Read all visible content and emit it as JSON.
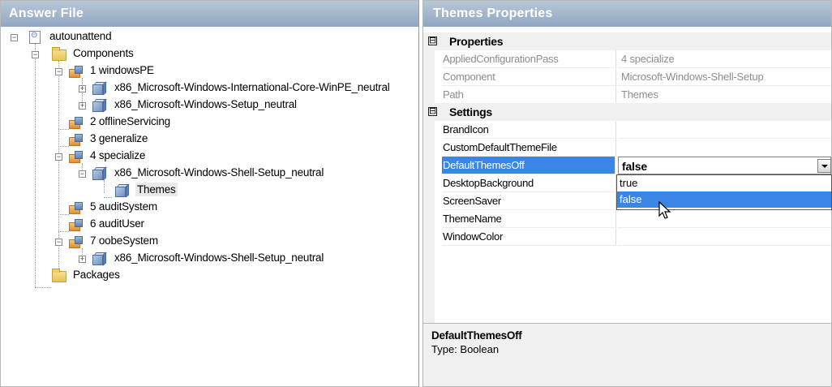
{
  "answer_file": {
    "title": "Answer File",
    "tree": [
      {
        "label": "autounattend",
        "icon": "answer-file-icon"
      },
      {
        "label": "Components",
        "icon": "folder-icon"
      },
      {
        "label": "1 windowsPE",
        "icon": "config-pass-icon"
      },
      {
        "label": "x86_Microsoft-Windows-International-Core-WinPE_neutral",
        "icon": "component-icon"
      },
      {
        "label": "x86_Microsoft-Windows-Setup_neutral",
        "icon": "component-icon"
      },
      {
        "label": "2 offlineServicing",
        "icon": "config-pass-icon"
      },
      {
        "label": "3 generalize",
        "icon": "config-pass-icon"
      },
      {
        "label": "4 specialize",
        "icon": "config-pass-icon"
      },
      {
        "label": "x86_Microsoft-Windows-Shell-Setup_neutral",
        "icon": "component-icon"
      },
      {
        "label": "Themes",
        "icon": "component-icon",
        "selected": true
      },
      {
        "label": "5 auditSystem",
        "icon": "config-pass-icon"
      },
      {
        "label": "6 auditUser",
        "icon": "config-pass-icon"
      },
      {
        "label": "7 oobeSystem",
        "icon": "config-pass-icon"
      },
      {
        "label": "x86_Microsoft-Windows-Shell-Setup_neutral",
        "icon": "component-icon"
      },
      {
        "label": "Packages",
        "icon": "folder-icon"
      }
    ]
  },
  "properties": {
    "title": "Themes Properties",
    "categories": [
      {
        "label": "Properties",
        "rows": [
          {
            "name": "AppliedConfigurationPass",
            "value": "4 specialize"
          },
          {
            "name": "Component",
            "value": "Microsoft-Windows-Shell-Setup"
          },
          {
            "name": "Path",
            "value": "Themes"
          }
        ]
      },
      {
        "label": "Settings",
        "rows": [
          {
            "name": "BrandIcon",
            "value": ""
          },
          {
            "name": "CustomDefaultThemeFile",
            "value": ""
          },
          {
            "name": "DefaultThemesOff",
            "value": "false"
          },
          {
            "name": "DesktopBackground",
            "value": ""
          },
          {
            "name": "ScreenSaver",
            "value": ""
          },
          {
            "name": "ThemeName",
            "value": ""
          },
          {
            "name": "WindowColor",
            "value": ""
          }
        ]
      }
    ],
    "collapse_glyph": "⊟",
    "dropdown_options": [
      "true",
      "false"
    ],
    "dropdown_highlighted": "false",
    "description": {
      "title": "DefaultThemesOff",
      "text": "Type: Boolean"
    }
  }
}
